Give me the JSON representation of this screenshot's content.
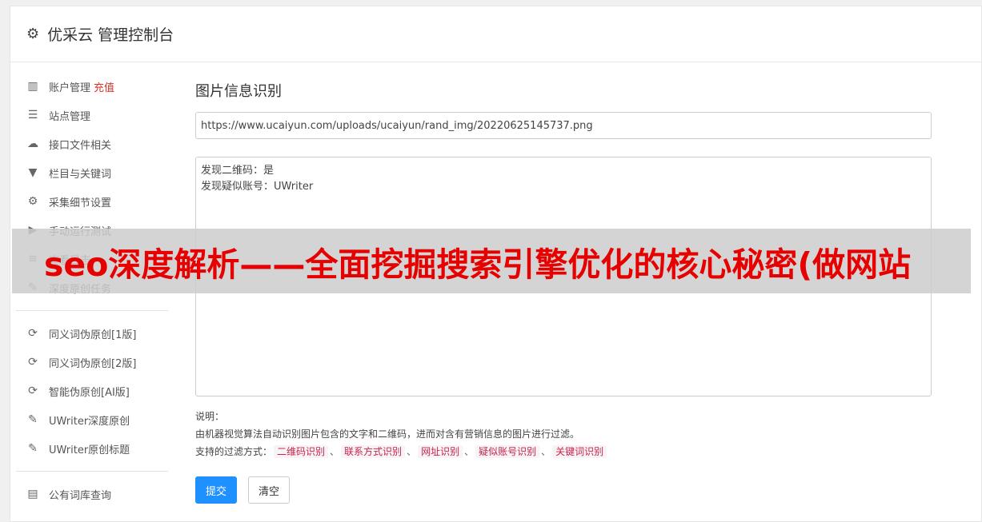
{
  "header": {
    "title": "优采云 管理控制台",
    "icon": "gear-icon"
  },
  "sidebar": {
    "group1": [
      {
        "label": "账户管理",
        "extra": "充值",
        "icon": "bar-chart-icon"
      },
      {
        "label": "站点管理",
        "icon": "server-icon"
      },
      {
        "label": "接口文件相关",
        "icon": "cloud-upload-icon"
      },
      {
        "label": "栏目与关键词",
        "icon": "filter-icon"
      },
      {
        "label": "采集细节设置",
        "icon": "gears-icon"
      },
      {
        "label": "手动运行测试",
        "icon": "play-icon"
      },
      {
        "label": "查看日志",
        "icon": "database-icon"
      },
      {
        "label": "深度原创任务",
        "icon": "edit-icon"
      }
    ],
    "group2": [
      {
        "label": "同义词伪原创[1版]",
        "icon": "refresh-icon"
      },
      {
        "label": "同义词伪原创[2版]",
        "icon": "refresh-icon"
      },
      {
        "label": "智能伪原创[AI版]",
        "icon": "refresh-icon"
      },
      {
        "label": "UWriter深度原创",
        "icon": "edit-icon"
      },
      {
        "label": "UWriter原创标题",
        "icon": "edit-icon"
      }
    ],
    "group3": [
      {
        "label": "公有词库查询",
        "icon": "book-icon"
      }
    ]
  },
  "main": {
    "title": "图片信息识别",
    "url_value": "https://www.ucaiyun.com/uploads/ucaiyun/rand_img/20220625145737.png",
    "result_lines": [
      "发现二维码：是",
      "发现疑似账号：UWriter"
    ],
    "note_label": "说明：",
    "note_desc": "由机器视觉算法自动识别图片包含的文字和二维码，进而对含有营销信息的图片进行过滤。",
    "filter_label": "支持的过滤方式：",
    "filter_tags": [
      "二维码识别",
      "联系方式识别",
      "网址识别",
      "疑似账号识别",
      "关键词识别"
    ],
    "separator": "、",
    "submit_label": "提交",
    "clear_label": "清空"
  },
  "overlay": {
    "text": "seo深度解析——全面挖掘搜索引擎优化的核心秘密(做网站"
  }
}
